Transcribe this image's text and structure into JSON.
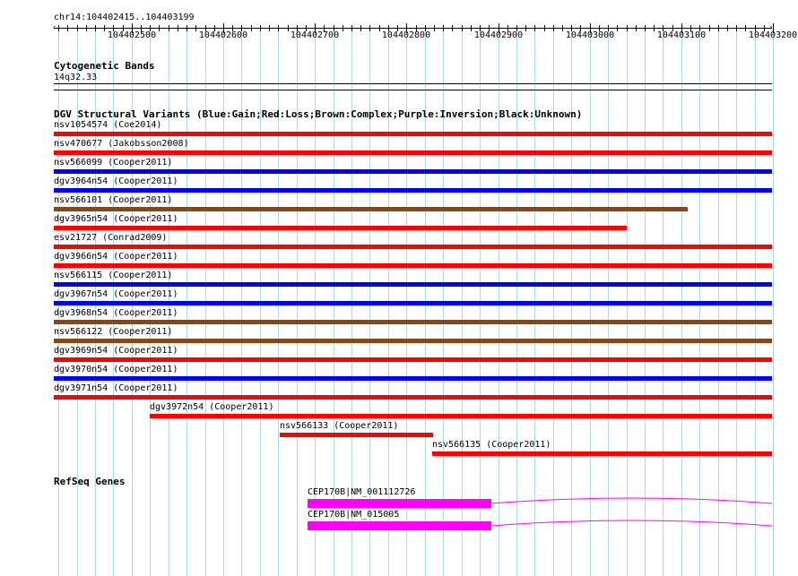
{
  "location": "chr14:104402415..104403199",
  "ruler": {
    "start": 104402415,
    "end": 104403199,
    "ticks": [
      "104402500",
      "104402600",
      "104402700",
      "104402800",
      "104402900",
      "104403000",
      "104403100",
      "104403200"
    ]
  },
  "cytoband": {
    "title": "Cytogenetic Bands",
    "band": "14q32.33"
  },
  "dgv": {
    "title": "DGV Structural Variants (Blue:Gain;Red:Loss;Brown:Complex;Purple:Inversion;Black:Unknown)",
    "colors": {
      "gain": "#0000ff",
      "loss": "#ff0000",
      "complex": "#8b4513",
      "inversion": "#800080",
      "unknown": "#000000"
    },
    "variants": [
      {
        "label": "nsv1054574 (Coe2014)",
        "type": "loss",
        "start": 104402415,
        "end": 104403199
      },
      {
        "label": "nsv470677 (Jakobsson2008)",
        "type": "loss",
        "start": 104402415,
        "end": 104403199
      },
      {
        "label": "nsv566099 (Cooper2011)",
        "type": "gain",
        "start": 104402415,
        "end": 104403199
      },
      {
        "label": "dgv3964n54 (Cooper2011)",
        "type": "gain",
        "start": 104402415,
        "end": 104403199
      },
      {
        "label": "nsv566101 (Cooper2011)",
        "type": "complex",
        "start": 104402415,
        "end": 104403107
      },
      {
        "label": "dgv3965n54 (Cooper2011)",
        "type": "loss",
        "start": 104402415,
        "end": 104403040
      },
      {
        "label": "esv21727 (Conrad2009)",
        "type": "loss",
        "start": 104402415,
        "end": 104403199
      },
      {
        "label": "dgv3966n54 (Cooper2011)",
        "type": "loss",
        "start": 104402415,
        "end": 104403199
      },
      {
        "label": "nsv566115 (Cooper2011)",
        "type": "gain",
        "start": 104402415,
        "end": 104403199
      },
      {
        "label": "dgv3967n54 (Cooper2011)",
        "type": "gain",
        "start": 104402415,
        "end": 104403199
      },
      {
        "label": "dgv3968n54 (Cooper2011)",
        "type": "complex",
        "start": 104402415,
        "end": 104403199
      },
      {
        "label": "nsv566122 (Cooper2011)",
        "type": "complex",
        "start": 104402415,
        "end": 104403199
      },
      {
        "label": "dgv3969n54 (Cooper2011)",
        "type": "loss",
        "start": 104402415,
        "end": 104403199
      },
      {
        "label": "dgv3970n54 (Cooper2011)",
        "type": "gain",
        "start": 104402415,
        "end": 104403199
      },
      {
        "label": "dgv3971n54 (Cooper2011)",
        "type": "loss",
        "start": 104402415,
        "end": 104403199
      },
      {
        "label": "dgv3972n54 (Cooper2011)",
        "type": "loss",
        "start": 104402520,
        "end": 104403199
      },
      {
        "label": "nsv566133 (Cooper2011)",
        "type": "loss",
        "start": 104402662,
        "end": 104402829
      },
      {
        "label": "nsv566135 (Cooper2011)",
        "type": "loss",
        "start": 104402828,
        "end": 104403199
      }
    ]
  },
  "refseq": {
    "title": "RefSeq Genes",
    "color": "#ff00ff",
    "genes": [
      {
        "label": "CEP170B|NM_001112726",
        "exon_start": 104402692,
        "exon_end": 104402893,
        "end": 104403199
      },
      {
        "label": "CEP170B|NM_015005",
        "exon_start": 104402692,
        "exon_end": 104402893,
        "end": 104403199
      }
    ]
  }
}
